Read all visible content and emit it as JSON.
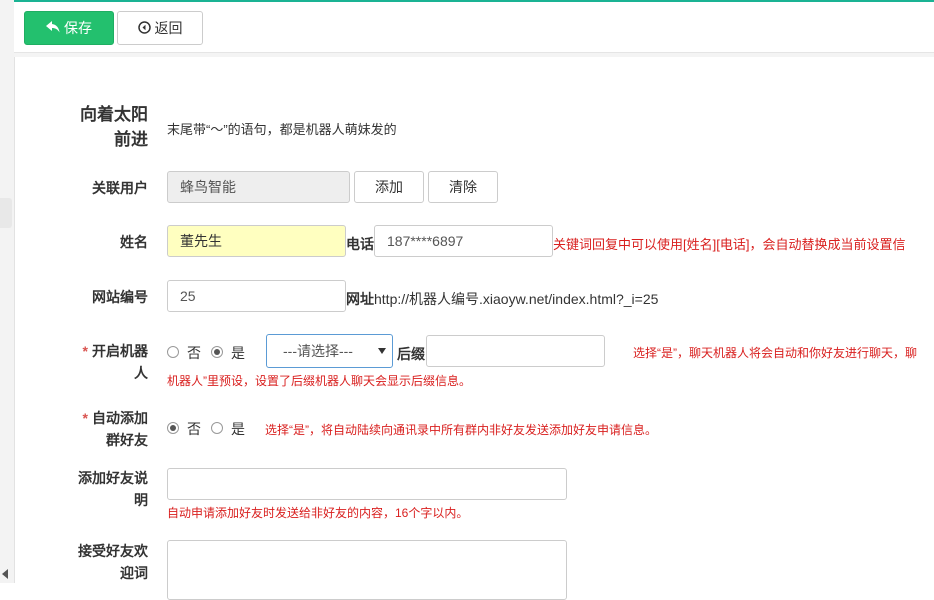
{
  "toolbar": {
    "save_label": "保存",
    "back_label": "返回"
  },
  "header": {
    "title_line1": "向着太阳",
    "title_line2": "前进",
    "subtitle": "末尾带“～”的语句，都是机器人萌妹发的"
  },
  "user": {
    "label": "关联用户",
    "value": "蜂鸟智能",
    "add_label": "添加",
    "clear_label": "清除"
  },
  "name": {
    "label": "姓名",
    "value": "董先生",
    "phone_label": "电话",
    "phone_value": "187****6897",
    "hint": "关键词回复中可以使用[姓名][电话]，会自动替换成当前设置信"
  },
  "site": {
    "label": "网站编号",
    "value": "25",
    "url_label": "网址",
    "url_value": "http://机器人编号.xiaoyw.net/index.html?_i=25"
  },
  "robot": {
    "label_line1": "开启机器",
    "label_line2": "人",
    "required": "*",
    "no_label": "否",
    "yes_label": "是",
    "select_value": "---请选择---",
    "suffix_label": "后缀",
    "hint_line1": "选择“是”，聊天机器人将会自动和你好友进行聊天，聊",
    "hint_line2": "机器人”里预设，设置了后缀机器人聊天会显示后缀信息。"
  },
  "group": {
    "label_line1": "自动添加",
    "label_line2": "群好友",
    "required": "*",
    "no_label": "否",
    "yes_label": "是",
    "hint": "选择“是”，将自动陆续向通讯录中所有群内非好友发送添加好友申请信息。"
  },
  "friend_note": {
    "label_line1": "添加好友说",
    "label_line2": "明",
    "hint": "自动申请添加好友时发送给非好友的内容，16个字以内。"
  },
  "welcome": {
    "label_line1": "接受好友欢",
    "label_line2": "迎词"
  }
}
